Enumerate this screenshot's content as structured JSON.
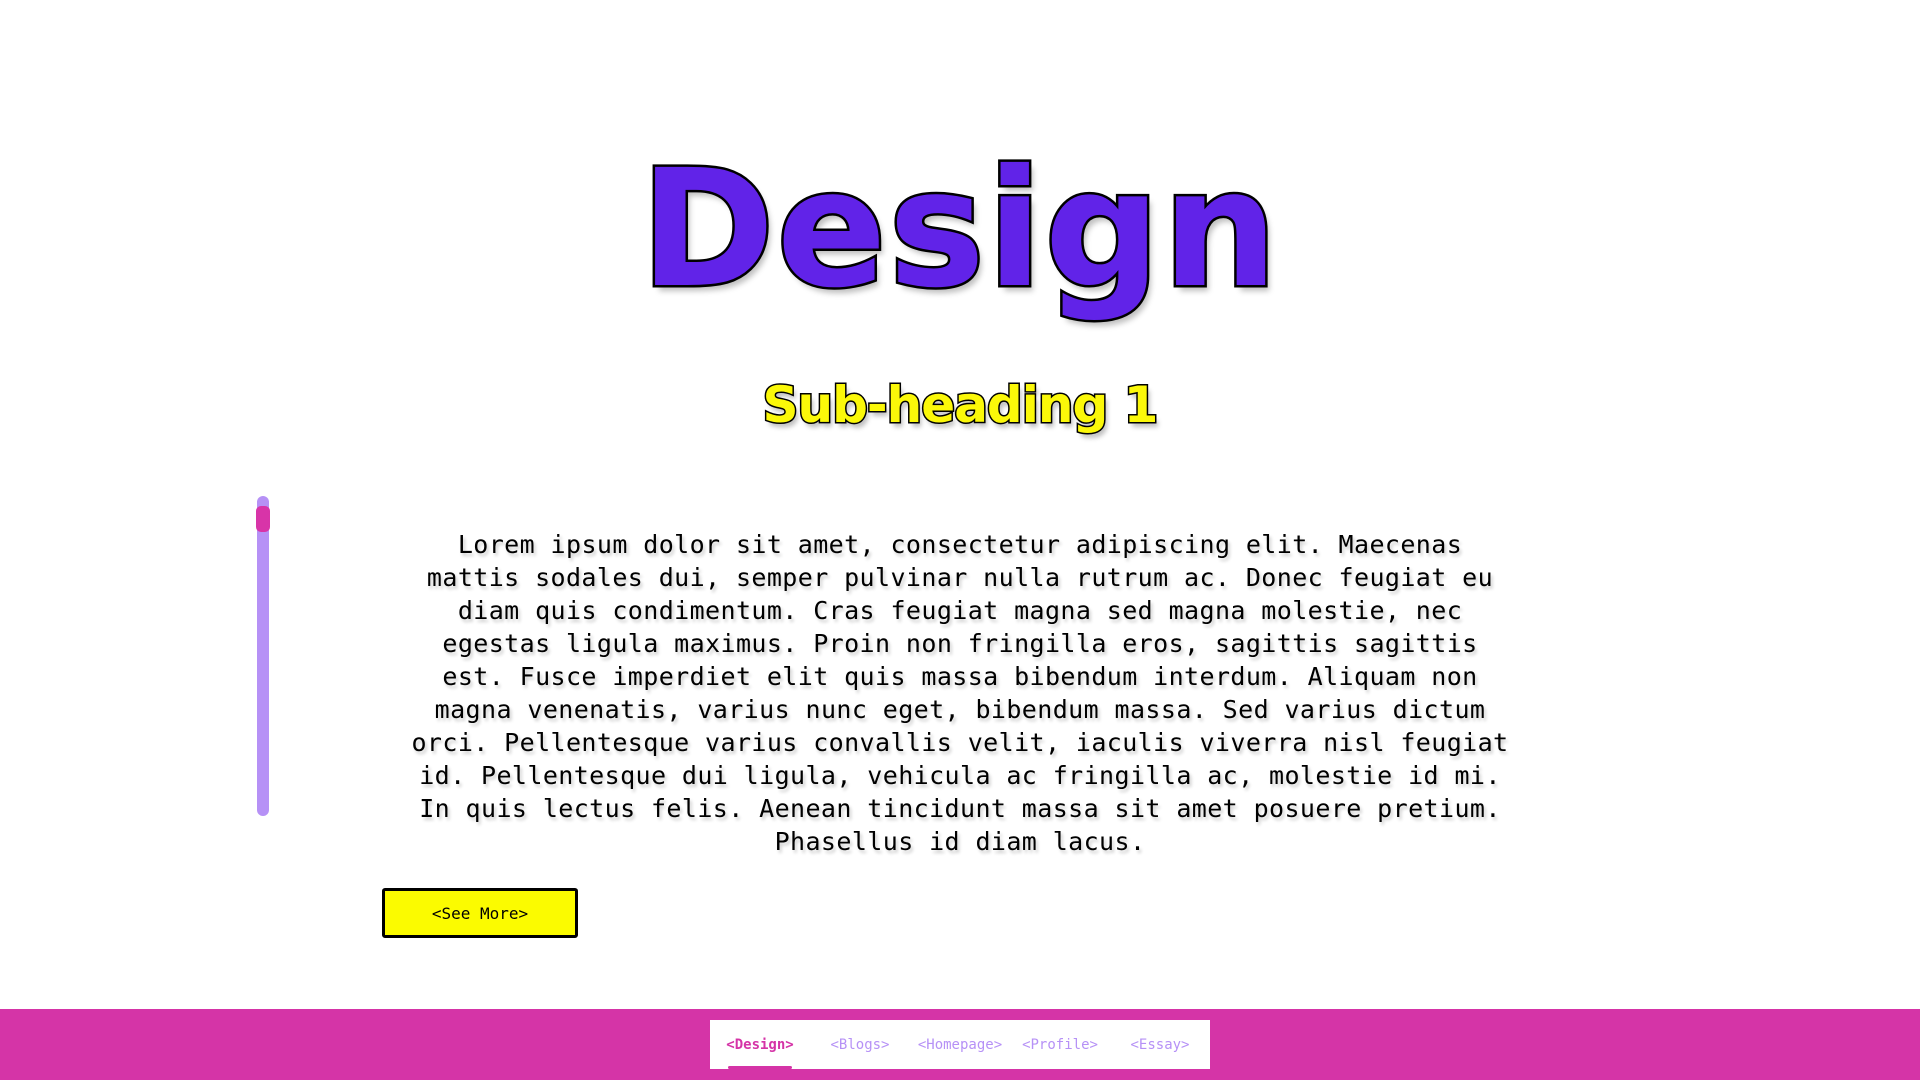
{
  "page": {
    "title": "Design",
    "subheading": "Sub-heading 1",
    "body_text": "Lorem ipsum dolor sit amet, consectetur adipiscing elit. Maecenas mattis sodales dui, semper pulvinar nulla rutrum ac. Donec feugiat eu diam quis condimentum. Cras feugiat magna sed magna molestie, nec egestas ligula maximus. Proin non fringilla eros, sagittis sagittis est. Fusce imperdiet elit quis massa bibendum interdum. Aliquam non magna venenatis, varius nunc eget, bibendum massa. Sed varius dictum orci. Pellentesque varius convallis velit, iaculis viverra nisl feugiat id. Pellentesque dui ligula, vehicula ac fringilla ac, molestie id mi. In quis lectus felis. Aenean tincidunt massa sit amet posuere pretium. Phasellus id diam lacus.",
    "see_more_label": "<See More>",
    "scroll_position": 0
  },
  "nav": {
    "items": [
      {
        "label": "<Design>",
        "active": true
      },
      {
        "label": "<Blogs>",
        "active": false
      },
      {
        "label": "<Homepage>",
        "active": false
      },
      {
        "label": "<Profile>",
        "active": false
      },
      {
        "label": "<Essay>",
        "active": false
      }
    ]
  },
  "colors": {
    "title_purple": "#6123e8",
    "subheading_yellow": "#fbf809",
    "accent_magenta": "#d534a7",
    "scroll_track_lavender": "#b691f6",
    "button_yellow": "#fbfb00"
  }
}
